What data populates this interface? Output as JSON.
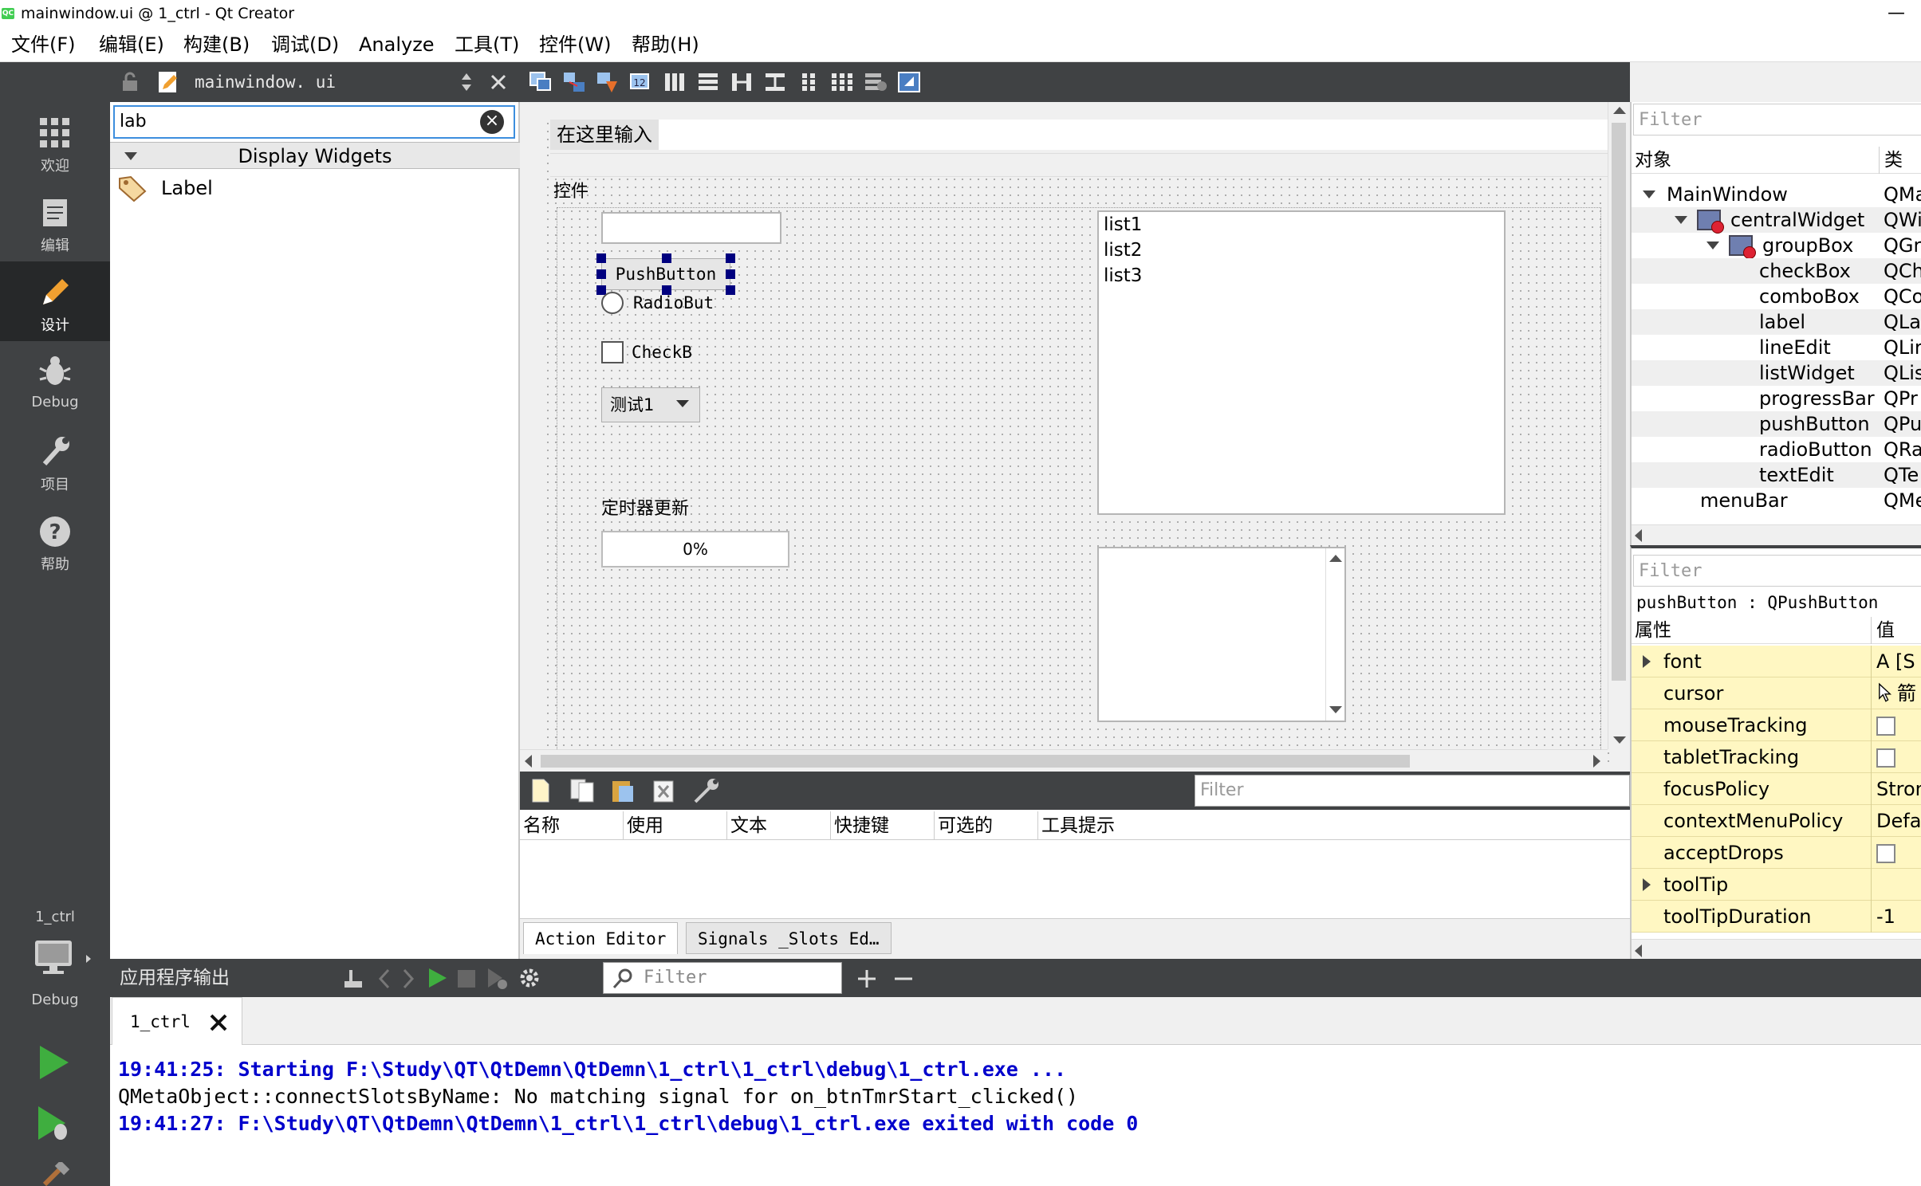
{
  "window": {
    "title": "mainwindow.ui @ 1_ctrl - Qt Creator",
    "app_icon_text": "QC",
    "minimize_glyph": "—"
  },
  "menubar": {
    "items": [
      "文件(F)",
      "编辑(E)",
      "构建(B)",
      "调试(D)",
      "Analyze",
      "工具(T)",
      "控件(W)",
      "帮助(H)"
    ]
  },
  "modes": [
    {
      "label": "欢迎",
      "icon": "grid-icon"
    },
    {
      "label": "编辑",
      "icon": "document-icon"
    },
    {
      "label": "设计",
      "icon": "pencil-icon",
      "active": true
    },
    {
      "label": "Debug",
      "icon": "bug-icon"
    },
    {
      "label": "项目",
      "icon": "wrench-icon"
    },
    {
      "label": "帮助",
      "icon": "help-icon"
    }
  ],
  "kit_selector": {
    "project": "1_ctrl",
    "build": "Debug"
  },
  "document_bar": {
    "file": "mainwindow. ui"
  },
  "widget_box": {
    "filter_value": "lab",
    "category": "Display Widgets",
    "items": [
      {
        "label": "Label",
        "icon": "label-tag-icon"
      }
    ]
  },
  "form": {
    "menu_type_here": "在这里输入",
    "groupbox_title": "控件",
    "pushbutton_text": "PushButton",
    "radio_text": "RadioBut",
    "checkbox_text": "CheckB",
    "combo_value": "测试1",
    "timer_label": "定时器更新",
    "progress_text": "0%",
    "progress_value": 0,
    "list_items": [
      "list1",
      "list2",
      "list3"
    ]
  },
  "action_editor": {
    "filter_placeholder": "Filter",
    "columns": [
      "名称",
      "使用",
      "文本",
      "快捷键",
      "可选的",
      "工具提示"
    ],
    "tabs": [
      "Action Editor",
      "Signals _Slots Ed…"
    ]
  },
  "object_inspector": {
    "filter_placeholder": "Filter",
    "col_object": "对象",
    "col_class": "类",
    "rows": [
      {
        "name": "MainWindow",
        "cls": "QMa",
        "indent": 0,
        "expand": "open"
      },
      {
        "name": "centralWidget",
        "cls": "QWi",
        "indent": 1,
        "expand": "open",
        "icon": true
      },
      {
        "name": "groupBox",
        "cls": "QGr",
        "indent": 2,
        "expand": "open",
        "icon": true
      },
      {
        "name": "checkBox",
        "cls": "QCh",
        "indent": 3
      },
      {
        "name": "comboBox",
        "cls": "QCo",
        "indent": 3
      },
      {
        "name": "label",
        "cls": "QLal",
        "indent": 3
      },
      {
        "name": "lineEdit",
        "cls": "QLir",
        "indent": 3
      },
      {
        "name": "listWidget",
        "cls": "QLis",
        "indent": 3
      },
      {
        "name": "progressBar",
        "cls": "QPr",
        "indent": 3
      },
      {
        "name": "pushButton",
        "cls": "QPu",
        "indent": 3
      },
      {
        "name": "radioButton",
        "cls": "QRa",
        "indent": 3
      },
      {
        "name": "textEdit",
        "cls": "QTe",
        "indent": 3
      },
      {
        "name": "menuBar",
        "cls": "QMe",
        "indent": 1
      }
    ]
  },
  "property_editor": {
    "filter_placeholder": "Filter",
    "object_label": "pushButton : QPushButton",
    "col_property": "属性",
    "col_value": "值",
    "rows": [
      {
        "name": "font",
        "value": "A  [S",
        "expandable": true
      },
      {
        "name": "cursor",
        "value": "箭",
        "cursor_icon": true
      },
      {
        "name": "mouseTracking",
        "checkbox": true
      },
      {
        "name": "tabletTracking",
        "checkbox": true
      },
      {
        "name": "focusPolicy",
        "value": "Stron"
      },
      {
        "name": "contextMenuPolicy",
        "value": "Defa"
      },
      {
        "name": "acceptDrops",
        "checkbox": true
      },
      {
        "name": "toolTip",
        "value": "",
        "expandable": true
      },
      {
        "name": "toolTipDuration",
        "value": "-1"
      }
    ]
  },
  "output": {
    "title": "应用程序输出",
    "filter_placeholder": "Filter",
    "tab": "1_ctrl",
    "lines": [
      {
        "text": "19:41:25: Starting F:\\Study\\QT\\QtDemn\\QtDemn\\1_ctrl\\1_ctrl\\debug\\1_ctrl.exe ...",
        "style": "blue"
      },
      {
        "text": "QMetaObject::connectSlotsByName: No matching signal for on_btnTmrStart_clicked()",
        "style": "normal"
      },
      {
        "text": "19:41:27: F:\\Study\\QT\\QtDemn\\QtDemn\\1_ctrl\\1_ctrl\\debug\\1_ctrl.exe exited with code 0",
        "style": "blue"
      }
    ]
  },
  "colors": {
    "dark_panel": "#404244",
    "active_mode": "#262829",
    "property_row": "#fff7c2",
    "output_blue": "#0000cc",
    "selection_handle": "#00007f"
  }
}
